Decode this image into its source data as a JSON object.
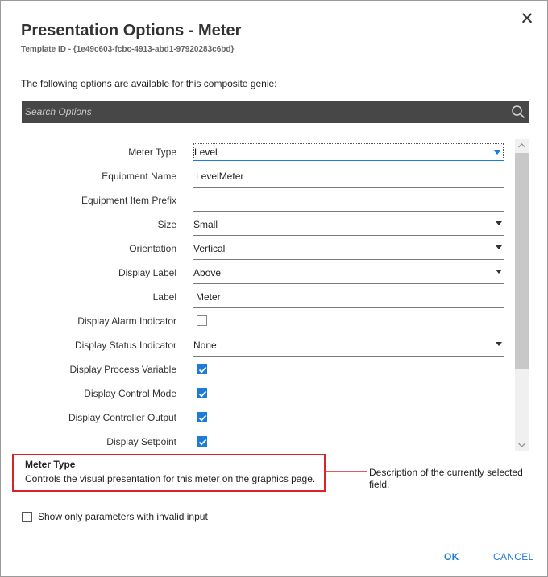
{
  "dialog": {
    "title": "Presentation Options - Meter",
    "template_id": "Template ID - {1e49c603-fcbc-4913-abd1-97920283c6bd}",
    "intro": "The following options are available for this composite genie:",
    "close_icon": "close-icon"
  },
  "search": {
    "placeholder": "Search Options",
    "icon": "search-icon"
  },
  "options": [
    {
      "label": "Meter Type",
      "kind": "dropdown",
      "value": "Level",
      "focused": true
    },
    {
      "label": "Equipment Name",
      "kind": "text",
      "value": "LevelMeter"
    },
    {
      "label": "Equipment Item Prefix",
      "kind": "text",
      "value": ""
    },
    {
      "label": "Size",
      "kind": "dropdown",
      "value": "Small"
    },
    {
      "label": "Orientation",
      "kind": "dropdown",
      "value": "Vertical"
    },
    {
      "label": "Display Label",
      "kind": "dropdown",
      "value": "Above"
    },
    {
      "label": "Label",
      "kind": "text",
      "value": "Meter"
    },
    {
      "label": "Display Alarm Indicator",
      "kind": "checkbox",
      "checked": false
    },
    {
      "label": "Display Status Indicator",
      "kind": "dropdown",
      "value": "None"
    },
    {
      "label": "Display Process Variable",
      "kind": "checkbox",
      "checked": true
    },
    {
      "label": "Display Control Mode",
      "kind": "checkbox",
      "checked": true
    },
    {
      "label": "Display Controller Output",
      "kind": "checkbox",
      "checked": true
    },
    {
      "label": "Display Setpoint",
      "kind": "checkbox",
      "checked": true
    }
  ],
  "description": {
    "title": "Meter Type",
    "text": "Controls the visual presentation for this meter on the graphics page."
  },
  "callout": {
    "text": "Description of the currently selected field."
  },
  "invalid_filter": {
    "label": "Show only parameters with invalid input",
    "checked": false
  },
  "buttons": {
    "ok": "OK",
    "cancel": "CANCEL"
  },
  "colors": {
    "accent": "#1e7bd7",
    "search_bar": "#474747",
    "callout_red": "#d9222a"
  }
}
